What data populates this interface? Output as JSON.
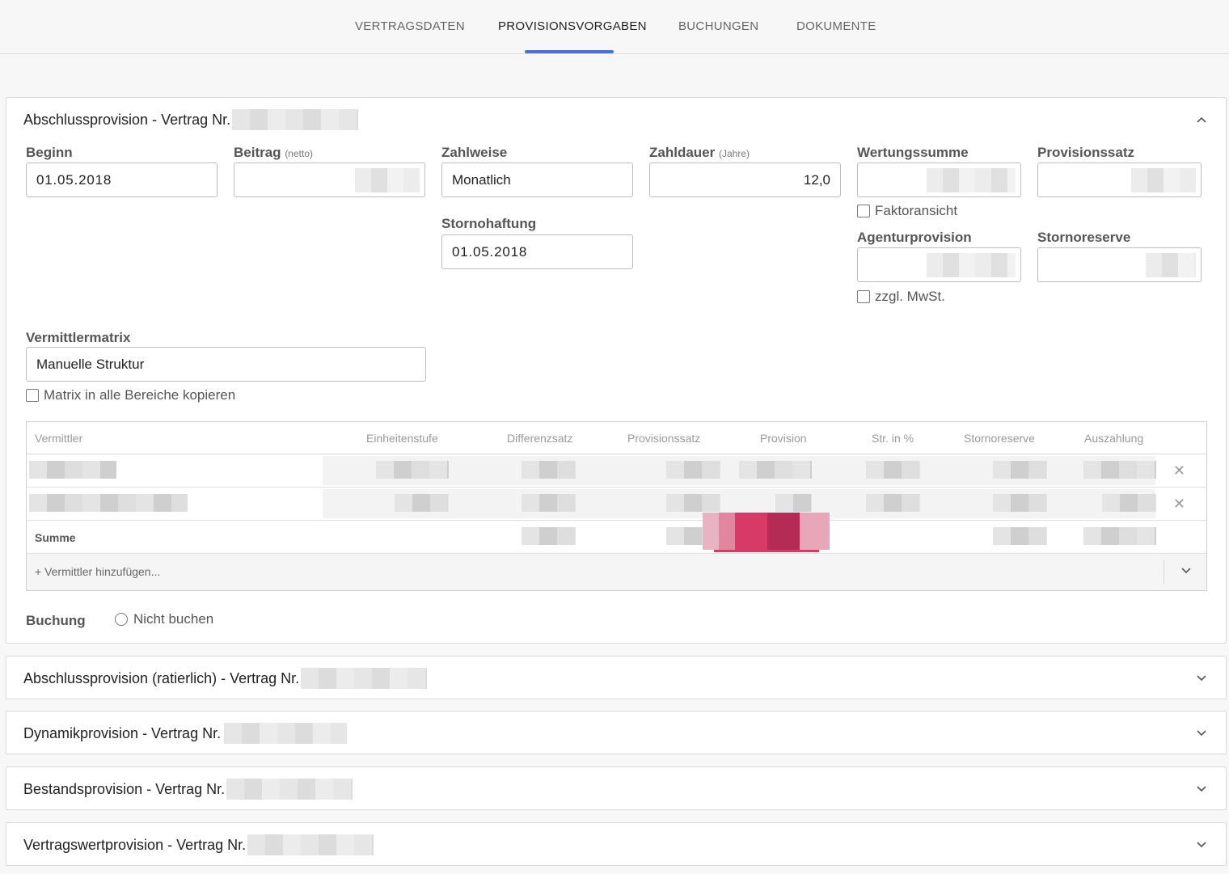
{
  "tabs": [
    {
      "label": "VERTRAGSDATEN",
      "active": false
    },
    {
      "label": "PROVISIONSVORGABEN",
      "active": true
    },
    {
      "label": "BUCHUNGEN",
      "active": false
    },
    {
      "label": "DOKUMENTE",
      "active": false
    }
  ],
  "main_panel": {
    "title": "Abschlussprovision - Vertrag Nr.",
    "fields": {
      "beginn": {
        "label": "Beginn",
        "value": "01.05.2018"
      },
      "beitrag": {
        "label": "Beitrag",
        "hint": "(netto)"
      },
      "zahlweise": {
        "label": "Zahlweise",
        "value": "Monatlich"
      },
      "zahldauer": {
        "label": "Zahldauer",
        "hint": "(Jahre)",
        "value": "12,0"
      },
      "wertungssumme": {
        "label": "Wertungssumme"
      },
      "provisionssatz": {
        "label": "Provisionssatz"
      },
      "faktoransicht": {
        "label": "Faktoransicht"
      },
      "stornohaftung": {
        "label": "Stornohaftung",
        "value": "01.05.2018"
      },
      "agenturprovision": {
        "label": "Agenturprovision"
      },
      "stornoreserve": {
        "label": "Stornoreserve"
      },
      "mwst": {
        "label": "zzgl. MwSt."
      },
      "vermittlermatrix": {
        "label": "Vermittlermatrix",
        "value": "Manuelle Struktur"
      },
      "matrix_copy": {
        "label": "Matrix in alle Bereiche kopieren"
      }
    },
    "table": {
      "headers": [
        "Vermittler",
        "Einheitenstufe",
        "Differenzsatz",
        "Provisionssatz",
        "Provision",
        "Str. in %",
        "Stornoreserve",
        "Auszahlung"
      ],
      "sum_label": "Summe",
      "add_label": "+ Vermittler hinzufügen..."
    },
    "buchung": {
      "label": "Buchung",
      "option": "Nicht buchen"
    }
  },
  "collapsed_panels": [
    {
      "title": "Abschlussprovision (ratierlich) - Vertrag Nr."
    },
    {
      "title": "Dynamikprovision - Vertrag Nr."
    },
    {
      "title": "Bestandsprovision - Vertrag Nr."
    },
    {
      "title": "Vertragswertprovision - Vertrag Nr."
    }
  ],
  "colors": {
    "accent": "#4a72d6",
    "highlight": "#d83a68"
  }
}
